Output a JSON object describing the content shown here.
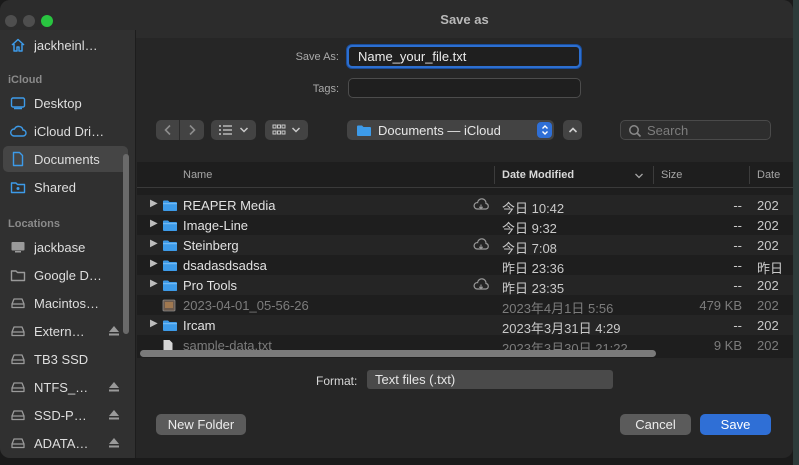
{
  "window": {
    "title": "Save as"
  },
  "sidebar": {
    "user_item": {
      "label": "jackheinl…",
      "icon": "home-icon"
    },
    "sections": {
      "icloud": "iCloud",
      "locations": "Locations"
    },
    "icloud_items": [
      {
        "label": "Desktop",
        "icon": "desktop-icon"
      },
      {
        "label": "iCloud Dri…",
        "icon": "cloud-icon"
      },
      {
        "label": "Documents",
        "icon": "document-icon",
        "selected": true
      },
      {
        "label": "Shared",
        "icon": "shared-folder-icon"
      }
    ],
    "location_items": [
      {
        "label": "jackbase",
        "icon": "computer-icon",
        "eject": false
      },
      {
        "label": "Google D…",
        "icon": "folder-icon",
        "eject": false
      },
      {
        "label": "Macintos…",
        "icon": "drive-icon",
        "eject": false
      },
      {
        "label": "Extern…",
        "icon": "drive-icon",
        "eject": true
      },
      {
        "label": "TB3 SSD",
        "icon": "drive-icon",
        "eject": false
      },
      {
        "label": "NTFS_…",
        "icon": "drive-icon",
        "eject": true
      },
      {
        "label": "SSD-P…",
        "icon": "drive-icon",
        "eject": true
      },
      {
        "label": "ADATA…",
        "icon": "drive-icon",
        "eject": true
      }
    ]
  },
  "form": {
    "save_as_label": "Save As:",
    "save_as_value": "Name_your_file.txt",
    "tags_label": "Tags:",
    "tags_value": ""
  },
  "toolbar": {
    "location_value": "Documents — iCloud",
    "search_placeholder": "Search"
  },
  "columns": {
    "name": "Name",
    "date": "Date Modified",
    "size": "Size",
    "date2": "Date"
  },
  "files": [
    {
      "name": "REAPER Media",
      "kind": "folder",
      "cloud": true,
      "date": "今日 10:42",
      "size": "--",
      "date2": "202",
      "dim": false
    },
    {
      "name": "Image-Line",
      "kind": "folder",
      "cloud": false,
      "date": "今日 9:32",
      "size": "--",
      "date2": "202",
      "dim": false
    },
    {
      "name": "Steinberg",
      "kind": "folder",
      "cloud": true,
      "date": "今日 7:08",
      "size": "--",
      "date2": "202",
      "dim": false
    },
    {
      "name": "dsadasdsadsa",
      "kind": "folder",
      "cloud": false,
      "date": "昨日 23:36",
      "size": "--",
      "date2": "昨日",
      "dim": false
    },
    {
      "name": "Pro Tools",
      "kind": "folder",
      "cloud": true,
      "date": "昨日 23:35",
      "size": "--",
      "date2": "202",
      "dim": false
    },
    {
      "name": "2023-04-01_05-56-26",
      "kind": "image",
      "cloud": false,
      "date": "2023年4月1日 5:56",
      "size": "479 KB",
      "date2": "202",
      "dim": true
    },
    {
      "name": "Ircam",
      "kind": "folder",
      "cloud": false,
      "date": "2023年3月31日 4:29",
      "size": "--",
      "date2": "202",
      "dim": false
    },
    {
      "name": "sample-data.txt",
      "kind": "text",
      "cloud": false,
      "date": "2023年3月30日 21:22",
      "size": "9 KB",
      "date2": "202",
      "dim": true
    }
  ],
  "bottom": {
    "format_label": "Format:",
    "format_value": "Text files (.txt)",
    "new_folder": "New Folder",
    "cancel": "Cancel",
    "save": "Save"
  },
  "colors": {
    "accent": "#2f6fd6",
    "folder": "#3d9be9",
    "window_bg": "#262626"
  }
}
